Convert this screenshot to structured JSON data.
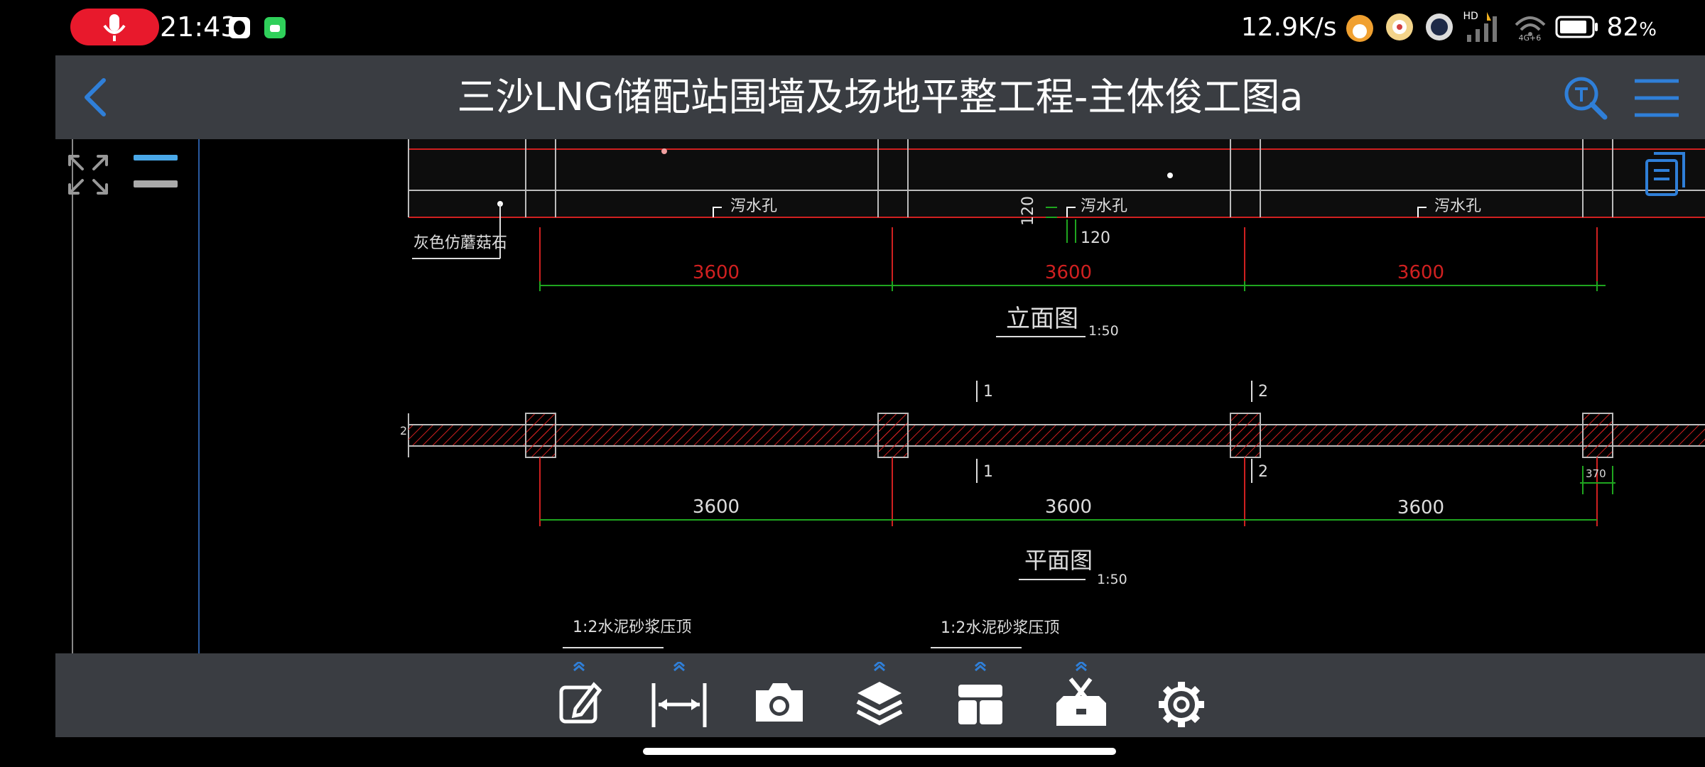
{
  "status_bar": {
    "time": "21:43",
    "network_speed": "12.9K/s",
    "battery_percent": "82",
    "battery_unit": "%",
    "hd_label": "HD",
    "signal_label": "4G+6"
  },
  "header": {
    "title": "三沙LNG储配站围墙及场地平整工程-主体俊工图a"
  },
  "drawing": {
    "material_label": "灰色仿蘑菇石",
    "drain_hole_label": "泻水孔",
    "dim_elevation_1": "3600",
    "dim_elevation_2": "3600",
    "dim_elevation_3": "3600",
    "dim_120_vertical": "120",
    "dim_120_horizontal": "120",
    "elevation_title": "立面图",
    "elevation_scale": "1:50",
    "section_mark_1": "1",
    "section_mark_2": "2",
    "plan_left_mark": "2",
    "dim_plan_1": "3600",
    "dim_plan_2": "3600",
    "dim_plan_3": "3600",
    "dim_370": "370",
    "plan_title": "平面图",
    "plan_scale": "1:50",
    "cap_note": "1:2水泥砂浆压顶"
  },
  "colors": {
    "accent_blue": "#2f7fd8",
    "header_bg": "#3a3d42",
    "cad_red": "#d02020",
    "cad_green": "#1fa51f",
    "cad_white": "#e6e6e6"
  },
  "toolbar": {
    "tools": [
      "edit-icon",
      "measure-icon",
      "camera-icon",
      "layers-icon",
      "layout-icon",
      "toolbox-icon",
      "settings-icon"
    ]
  }
}
